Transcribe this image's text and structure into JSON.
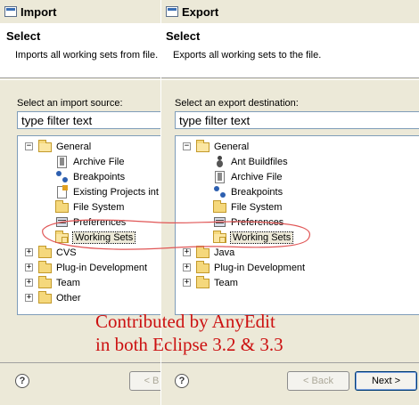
{
  "import": {
    "title": "Import",
    "header_title": "Select",
    "header_desc": "Imports all working sets from file.",
    "source_label": "Select an import source:",
    "filter_value": "type filter text",
    "tree": [
      {
        "label": "General",
        "expander": "−",
        "icon": "folder-open-icon"
      },
      {
        "label": "Archive File",
        "icon": "archive-file-icon"
      },
      {
        "label": "Breakpoints",
        "icon": "breakpoints-icon"
      },
      {
        "label": "Existing Projects int",
        "icon": "existing-projects-icon"
      },
      {
        "label": "File System",
        "icon": "file-system-icon"
      },
      {
        "label": "Preferences",
        "icon": "preferences-icon"
      },
      {
        "label": "Working Sets",
        "icon": "working-sets-icon"
      },
      {
        "label": "CVS",
        "expander": "+",
        "icon": "folder-icon"
      },
      {
        "label": "Plug-in Development",
        "expander": "+",
        "icon": "folder-icon"
      },
      {
        "label": "Team",
        "expander": "+",
        "icon": "folder-icon"
      },
      {
        "label": "Other",
        "expander": "+",
        "icon": "folder-icon"
      }
    ],
    "back_label": "< B"
  },
  "export": {
    "title": "Export",
    "header_title": "Select",
    "header_desc": "Exports all working sets to the file.",
    "dest_label": "Select an export destination:",
    "filter_value": "type filter text",
    "tree": [
      {
        "label": "General",
        "expander": "−",
        "icon": "folder-open-icon"
      },
      {
        "label": "Ant Buildfiles",
        "icon": "ant-icon"
      },
      {
        "label": "Archive File",
        "icon": "archive-file-icon"
      },
      {
        "label": "Breakpoints",
        "icon": "breakpoints-icon"
      },
      {
        "label": "File System",
        "icon": "file-system-icon"
      },
      {
        "label": "Preferences",
        "icon": "preferences-icon"
      },
      {
        "label": "Working Sets",
        "icon": "working-sets-icon"
      },
      {
        "label": "Java",
        "expander": "+",
        "icon": "folder-icon"
      },
      {
        "label": "Plug-in Development",
        "expander": "+",
        "icon": "folder-icon"
      },
      {
        "label": "Team",
        "expander": "+",
        "icon": "folder-icon"
      }
    ],
    "back_label": "< Back",
    "next_label": "Next >"
  },
  "help_glyph": "?",
  "annotation": {
    "line1": "Contributed by AnyEdit",
    "line2": "in both Eclipse 3.2 & 3.3",
    "color": "#cc1111"
  }
}
